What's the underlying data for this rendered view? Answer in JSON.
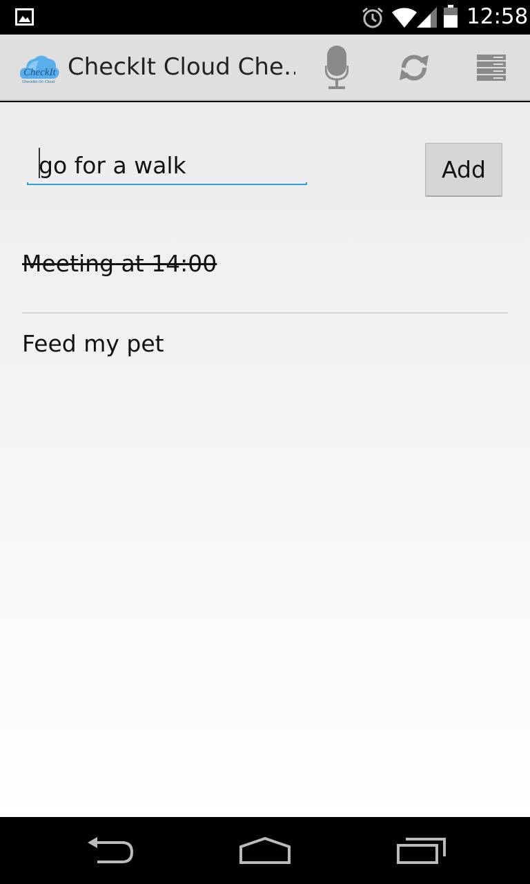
{
  "status_bar": {
    "time": "12:58",
    "icons": [
      "image-notification-icon",
      "alarm-icon",
      "wifi-icon",
      "signal-icon",
      "battery-icon"
    ]
  },
  "action_bar": {
    "title": "CheckIt Cloud Che…",
    "logo_text": "CheckIt",
    "logo_subtext": "Checklist On Cloud",
    "actions": [
      "mic-icon",
      "sync-icon",
      "overflow-menu-icon"
    ]
  },
  "input": {
    "value": "go for a walk",
    "add_label": "Add",
    "accent_color": "#2aa0d8"
  },
  "tasks": [
    {
      "text": "Meeting at 14:00",
      "done": true
    },
    {
      "text": "Feed my pet",
      "done": false
    }
  ],
  "nav_bar": {
    "icons": [
      "back-icon",
      "home-icon",
      "recents-icon"
    ]
  }
}
